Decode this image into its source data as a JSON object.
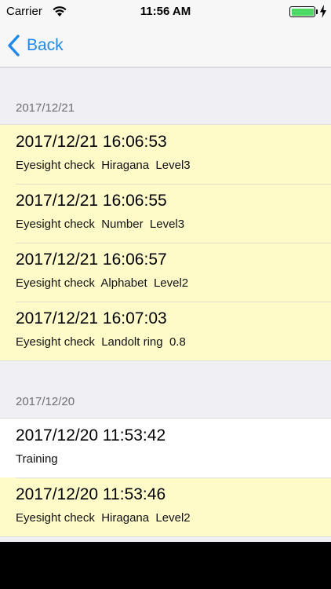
{
  "status_bar": {
    "carrier": "Carrier",
    "time": "11:56 AM",
    "battery_color": "#4cd964"
  },
  "nav": {
    "back_label": "Back",
    "back_icon": "chevron-left-icon",
    "accent_color": "#1a8af7"
  },
  "sections": [
    {
      "header": "2017/12/21",
      "rows": [
        {
          "title": "2017/12/21 16:06:53",
          "subtitle": "Eyesight check  Hiragana  Level3",
          "highlight": true
        },
        {
          "title": "2017/12/21 16:06:55",
          "subtitle": "Eyesight check  Number  Level3",
          "highlight": true
        },
        {
          "title": "2017/12/21 16:06:57",
          "subtitle": "Eyesight check  Alphabet  Level2",
          "highlight": true
        },
        {
          "title": "2017/12/21 16:07:03",
          "subtitle": "Eyesight check  Landolt ring  0.8",
          "highlight": true
        }
      ]
    },
    {
      "header": "2017/12/20",
      "rows": [
        {
          "title": "2017/12/20 11:53:42",
          "subtitle": "Training",
          "highlight": false
        },
        {
          "title": "2017/12/20 11:53:46",
          "subtitle": "Eyesight check  Hiragana  Level2",
          "highlight": true
        }
      ]
    }
  ]
}
